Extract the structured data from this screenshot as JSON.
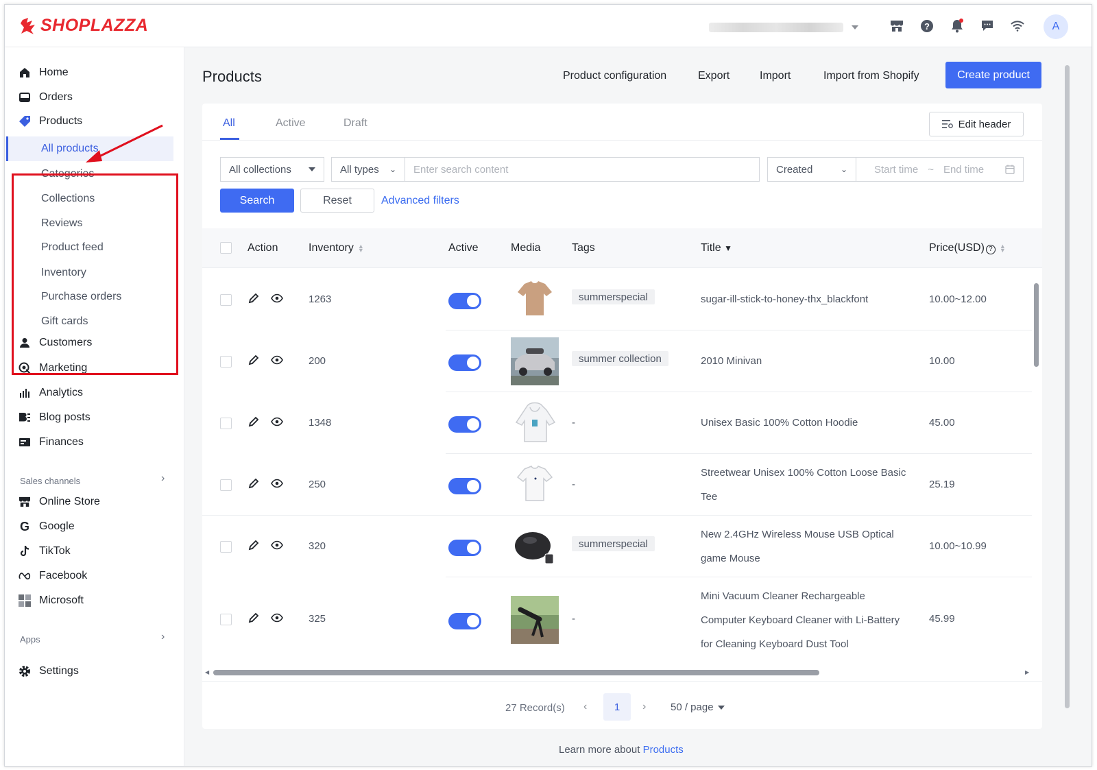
{
  "brand": {
    "logo_text": "SHOPLAZZA",
    "color": "#e8282f"
  },
  "topbar": {
    "avatar_letter": "A",
    "icons": [
      "store-icon",
      "help-icon",
      "bell-icon",
      "chat-icon",
      "wifi-icon"
    ]
  },
  "sidebar": {
    "items": [
      {
        "label": "Home",
        "icon": "home-icon"
      },
      {
        "label": "Orders",
        "icon": "orders-icon"
      },
      {
        "label": "Products",
        "icon": "tag-icon"
      }
    ],
    "product_subitems": [
      {
        "label": "All products",
        "active": true
      },
      {
        "label": "Categories"
      },
      {
        "label": "Collections"
      },
      {
        "label": "Reviews"
      },
      {
        "label": "Product feed"
      },
      {
        "label": "Inventory"
      },
      {
        "label": "Purchase orders"
      },
      {
        "label": "Gift cards"
      }
    ],
    "items_after": [
      {
        "label": "Customers",
        "icon": "user-icon"
      },
      {
        "label": "Marketing",
        "icon": "marketing-icon"
      },
      {
        "label": "Analytics",
        "icon": "analytics-icon"
      },
      {
        "label": "Blog posts",
        "icon": "blog-icon"
      },
      {
        "label": "Finances",
        "icon": "finances-icon"
      }
    ],
    "sales_channels_label": "Sales channels",
    "sales_channels": [
      {
        "label": "Online Store",
        "icon": "store-icon"
      },
      {
        "label": "Google",
        "icon": "google-icon"
      },
      {
        "label": "TikTok",
        "icon": "tiktok-icon"
      },
      {
        "label": "Facebook",
        "icon": "meta-icon"
      },
      {
        "label": "Microsoft",
        "icon": "microsoft-icon"
      }
    ],
    "apps_label": "Apps",
    "settings_label": "Settings"
  },
  "header": {
    "title": "Products",
    "links": [
      "Product configuration",
      "Export",
      "Import",
      "Import from Shopify"
    ],
    "create_label": "Create product",
    "accent": "#3f6bf2"
  },
  "tabs": [
    {
      "label": "All",
      "active": true
    },
    {
      "label": "Active"
    },
    {
      "label": "Draft"
    }
  ],
  "edit_header_label": "Edit header",
  "filters": {
    "collections": "All collections",
    "types": "All types",
    "search_placeholder": "Enter search content",
    "date_type": "Created",
    "start_placeholder": "Start time",
    "range_sep": "~",
    "end_placeholder": "End time",
    "search_label": "Search",
    "reset_label": "Reset",
    "advanced_label": "Advanced filters"
  },
  "table": {
    "columns": [
      "Action",
      "Inventory",
      "Active",
      "Media",
      "Tags",
      "Title",
      "Price(USD)"
    ],
    "rows": [
      {
        "inventory": "1263",
        "active": true,
        "media": "tshirt-brown",
        "tag": "summerspecial",
        "title_lines": [
          "sugar-ill-stick-to-honey-thx_blackfont"
        ],
        "price": "10.00~12.00"
      },
      {
        "inventory": "200",
        "active": true,
        "media": "minivan",
        "tag": "summer collection",
        "title_lines": [
          "2010 Minivan"
        ],
        "price": "10.00"
      },
      {
        "inventory": "1348",
        "active": true,
        "media": "hoodie-white",
        "tag": "-",
        "title_lines": [
          "Unisex Basic 100% Cotton Hoodie"
        ],
        "price": "45.00"
      },
      {
        "inventory": "250",
        "active": true,
        "media": "tee-white",
        "tag": "-",
        "title_lines": [
          "Streetwear Unisex 100% Cotton Loose Basic",
          "Tee"
        ],
        "price": "25.19"
      },
      {
        "inventory": "320",
        "active": true,
        "media": "mouse-black",
        "tag": "summerspecial",
        "title_lines": [
          "New 2.4GHz Wireless Mouse USB Optical",
          "game Mouse"
        ],
        "price": "10.00~10.99"
      },
      {
        "inventory": "325",
        "active": true,
        "media": "vacuum",
        "tag": "-",
        "title_lines": [
          "Mini Vacuum Cleaner Rechargeable",
          "Computer Keyboard Cleaner with Li-Battery",
          "for Cleaning Keyboard Dust Tool"
        ],
        "price": "45.99"
      }
    ]
  },
  "pager": {
    "records": "27 Record(s)",
    "current_page": "1",
    "per_page": "50 / page"
  },
  "footer": {
    "learn_prefix": "Learn more about ",
    "learn_link": "Products"
  }
}
